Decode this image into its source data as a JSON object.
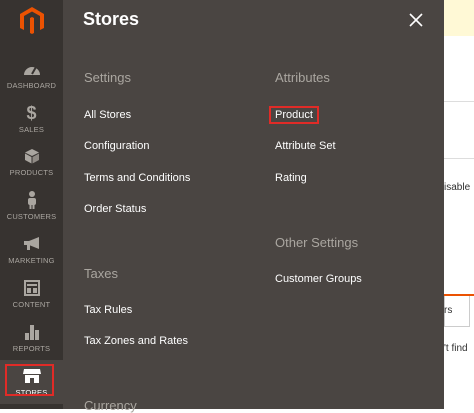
{
  "colors": {
    "sidebar_bg": "#373330",
    "panel_bg": "#4a4542",
    "accent_orange": "#eb5202",
    "highlight_red": "#e02b27",
    "muted_text": "#aaa6a0"
  },
  "sidebar": {
    "logo_icon": "magento-logo-icon",
    "items": [
      {
        "label": "DASHBOARD",
        "icon": "speedometer-icon",
        "active": false
      },
      {
        "label": "SALES",
        "icon": "dollar-icon",
        "active": false
      },
      {
        "label": "PRODUCTS",
        "icon": "cube-icon",
        "active": false
      },
      {
        "label": "CUSTOMERS",
        "icon": "person-icon",
        "active": false
      },
      {
        "label": "MARKETING",
        "icon": "megaphone-icon",
        "active": false
      },
      {
        "label": "CONTENT",
        "icon": "layout-icon",
        "active": false
      },
      {
        "label": "REPORTS",
        "icon": "bar-chart-icon",
        "active": false
      },
      {
        "label": "STORES",
        "icon": "storefront-icon",
        "active": true
      }
    ]
  },
  "panel": {
    "title": "Stores",
    "close_icon": "close-icon",
    "groups": {
      "settings": {
        "title": "Settings",
        "items": [
          "All Stores",
          "Configuration",
          "Terms and Conditions",
          "Order Status"
        ]
      },
      "taxes": {
        "title": "Taxes",
        "items": [
          "Tax Rules",
          "Tax Zones and Rates"
        ]
      },
      "currency": {
        "title": "Currency"
      },
      "attributes": {
        "title": "Attributes",
        "items": [
          "Product",
          "Attribute Set",
          "Rating"
        ],
        "highlighted": "Product"
      },
      "other_settings": {
        "title": "Other Settings",
        "items": [
          "Customer Groups"
        ]
      }
    }
  },
  "background_page": {
    "fragment_1": "isable",
    "fragment_2": "rs",
    "fragment_3": "'t find"
  }
}
